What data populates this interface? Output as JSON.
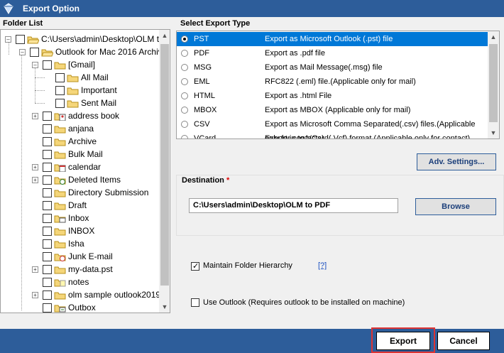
{
  "window": {
    "title": "Export Option"
  },
  "folder_list": {
    "heading": "Folder List",
    "items": [
      {
        "label": "C:\\Users\\admin\\Desktop\\OLM t",
        "level": 0,
        "expander": "-",
        "icon": "open-folder-icon"
      },
      {
        "label": "Outlook for Mac 2016 Archiv",
        "level": 1,
        "expander": "-",
        "icon": "open-folder-icon"
      },
      {
        "label": "[Gmail]",
        "level": 2,
        "expander": "-",
        "icon": "folder-icon"
      },
      {
        "label": "All Mail",
        "level": 3,
        "expander": "",
        "icon": "folder-icon"
      },
      {
        "label": "Important",
        "level": 3,
        "expander": "",
        "icon": "folder-icon"
      },
      {
        "label": "Sent Mail",
        "level": 3,
        "expander": "",
        "icon": "folder-icon"
      },
      {
        "label": "address book",
        "level": 2,
        "expander": "+",
        "icon": "contacts-icon"
      },
      {
        "label": "anjana",
        "level": 2,
        "expander": "",
        "icon": "folder-icon"
      },
      {
        "label": "Archive",
        "level": 2,
        "expander": "",
        "icon": "folder-icon"
      },
      {
        "label": "Bulk Mail",
        "level": 2,
        "expander": "",
        "icon": "folder-icon"
      },
      {
        "label": "calendar",
        "level": 2,
        "expander": "+",
        "icon": "calendar-icon"
      },
      {
        "label": "Deleted Items",
        "level": 2,
        "expander": "+",
        "icon": "recycle-icon"
      },
      {
        "label": "Directory Submission",
        "level": 2,
        "expander": "",
        "icon": "folder-icon"
      },
      {
        "label": "Draft",
        "level": 2,
        "expander": "",
        "icon": "folder-icon"
      },
      {
        "label": "Inbox",
        "level": 2,
        "expander": "",
        "icon": "inbox-icon"
      },
      {
        "label": "INBOX",
        "level": 2,
        "expander": "",
        "icon": "folder-icon"
      },
      {
        "label": "Isha",
        "level": 2,
        "expander": "",
        "icon": "folder-icon"
      },
      {
        "label": "Junk E-mail",
        "level": 2,
        "expander": "",
        "icon": "junk-icon"
      },
      {
        "label": "my-data.pst",
        "level": 2,
        "expander": "+",
        "icon": "folder-icon"
      },
      {
        "label": "notes",
        "level": 2,
        "expander": "",
        "icon": "notes-icon"
      },
      {
        "label": "olm sample outlook2019",
        "level": 2,
        "expander": "+",
        "icon": "folder-icon"
      },
      {
        "label": "Outbox",
        "level": 2,
        "expander": "",
        "icon": "outbox-icon"
      }
    ]
  },
  "export_type": {
    "heading": "Select Export Type",
    "options": [
      {
        "name": "PST",
        "desc": "Export as Microsoft Outlook (.pst) file",
        "selected": true
      },
      {
        "name": "PDF",
        "desc": "Export as .pdf file",
        "selected": false
      },
      {
        "name": "MSG",
        "desc": "Export as Mail Message(.msg) file",
        "selected": false
      },
      {
        "name": "EML",
        "desc": "RFC822 (.eml) file.(Applicable only for mail)",
        "selected": false
      },
      {
        "name": "HTML",
        "desc": "Export as .html File",
        "selected": false
      },
      {
        "name": "MBOX",
        "desc": "Export as MBOX (Applicable only for mail)",
        "selected": false
      },
      {
        "name": "CSV",
        "desc": "Export as Microsoft Comma Separated(.csv) files.(Applicable only for contacts)",
        "selected": false
      },
      {
        "name": "VCard",
        "desc": "Export in to VCard(.Vcf) format (Applicable only for contact)",
        "selected": false
      }
    ]
  },
  "adv_settings_label": "Adv. Settings...",
  "destination": {
    "heading": "Destination",
    "required_mark": "*",
    "path": "C:\\Users\\admin\\Desktop\\OLM to PDF",
    "browse_label": "Browse"
  },
  "maintain_hierarchy": {
    "label": "Maintain Folder Hierarchy",
    "checked": true,
    "help": "[?]"
  },
  "use_outlook": {
    "label": "Use Outlook (Requires outlook to be installed on machine)",
    "checked": false
  },
  "footer": {
    "export_label": "Export",
    "cancel_label": "Cancel"
  },
  "colors": {
    "titlebar": "#2d5d9a",
    "selection": "#0078d7",
    "highlight_frame": "#dd3333"
  }
}
